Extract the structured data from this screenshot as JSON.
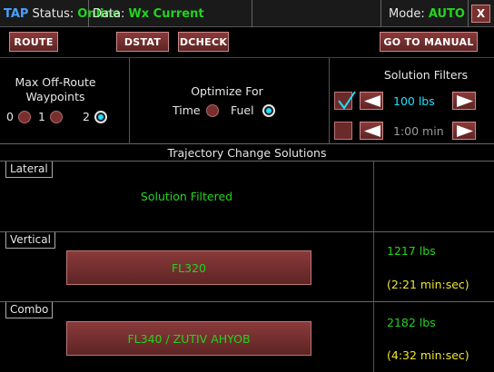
{
  "statusbar": {
    "app": "TAP",
    "status_label": "Status:",
    "status_value": "Online",
    "data_label": "Data:",
    "data_value": "Wx Current",
    "mode_label": "Mode:",
    "mode_value": "AUTO",
    "close_label": "X"
  },
  "toolbar": {
    "route": "ROUTE",
    "dstat": "DSTAT",
    "dcheck": "DCHECK",
    "goto_manual": "GO TO MANUAL"
  },
  "waypoints": {
    "title_line1": "Max Off-Route",
    "title_line2": "Waypoints",
    "options": [
      "0",
      "1",
      "2"
    ],
    "selected": "2"
  },
  "optimize": {
    "title": "Optimize For",
    "options": [
      "Time",
      "Fuel"
    ],
    "selected": "Fuel"
  },
  "filters": {
    "title": "Solution Filters",
    "fuel": {
      "value": "100 lbs",
      "checked": true,
      "color": "#1ee0ff"
    },
    "time": {
      "value": "1:00 min",
      "checked": false,
      "color": "#9a9a9a"
    }
  },
  "trajectory": {
    "header": "Trajectory Change Solutions",
    "lateral": {
      "tag": "Lateral",
      "message": "Solution Filtered"
    },
    "vertical": {
      "tag": "Vertical",
      "button": "FL320",
      "fuel": "1217 lbs",
      "time": "(2:21 min:sec)"
    },
    "combo": {
      "tag": "Combo",
      "button": "FL340 / ZUTIV AHYOB",
      "fuel": "2182 lbs",
      "time": "(4:32 min:sec)"
    }
  },
  "colors": {
    "accent_green": "#22d41e",
    "accent_cyan": "#1ee0ff",
    "accent_yellow": "#f0e62a",
    "button_red": "#7a2f2f"
  }
}
